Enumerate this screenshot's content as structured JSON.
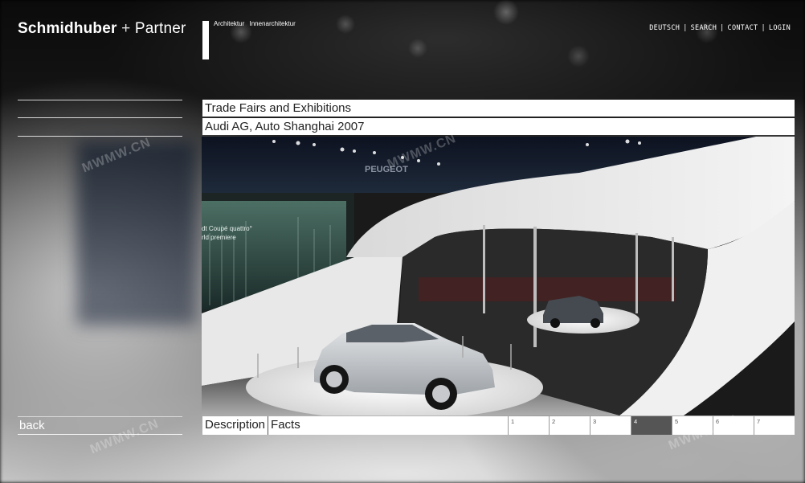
{
  "header": {
    "logo_bold": "Schmidhuber",
    "logo_plus": "+",
    "logo_rest": "Partner",
    "sublinks": [
      "Architektur",
      "Innenarchitektur"
    ],
    "nav": [
      "DEUTSCH",
      "SEARCH",
      "CONTACT",
      "LOGIN"
    ],
    "nav_separator": "|"
  },
  "content": {
    "category": "Trade Fairs and Exhibitions",
    "project": "Audi AG, Auto Shanghai 2007",
    "photo_text_1": "PEUGEOT",
    "photo_text_2": "dt Coupé quattro°",
    "photo_text_3": "rld premiere"
  },
  "sidebar": {
    "back_label": "back"
  },
  "footer": {
    "tabs": [
      "Description",
      "Facts"
    ],
    "pages": [
      "1",
      "2",
      "3",
      "4",
      "5",
      "6",
      "7"
    ],
    "active_page": 4
  },
  "watermark": "MWMW.CN",
  "colors": {
    "bar_bg": "#ffffff",
    "active_page_bg": "#555555",
    "text": "#222222"
  }
}
